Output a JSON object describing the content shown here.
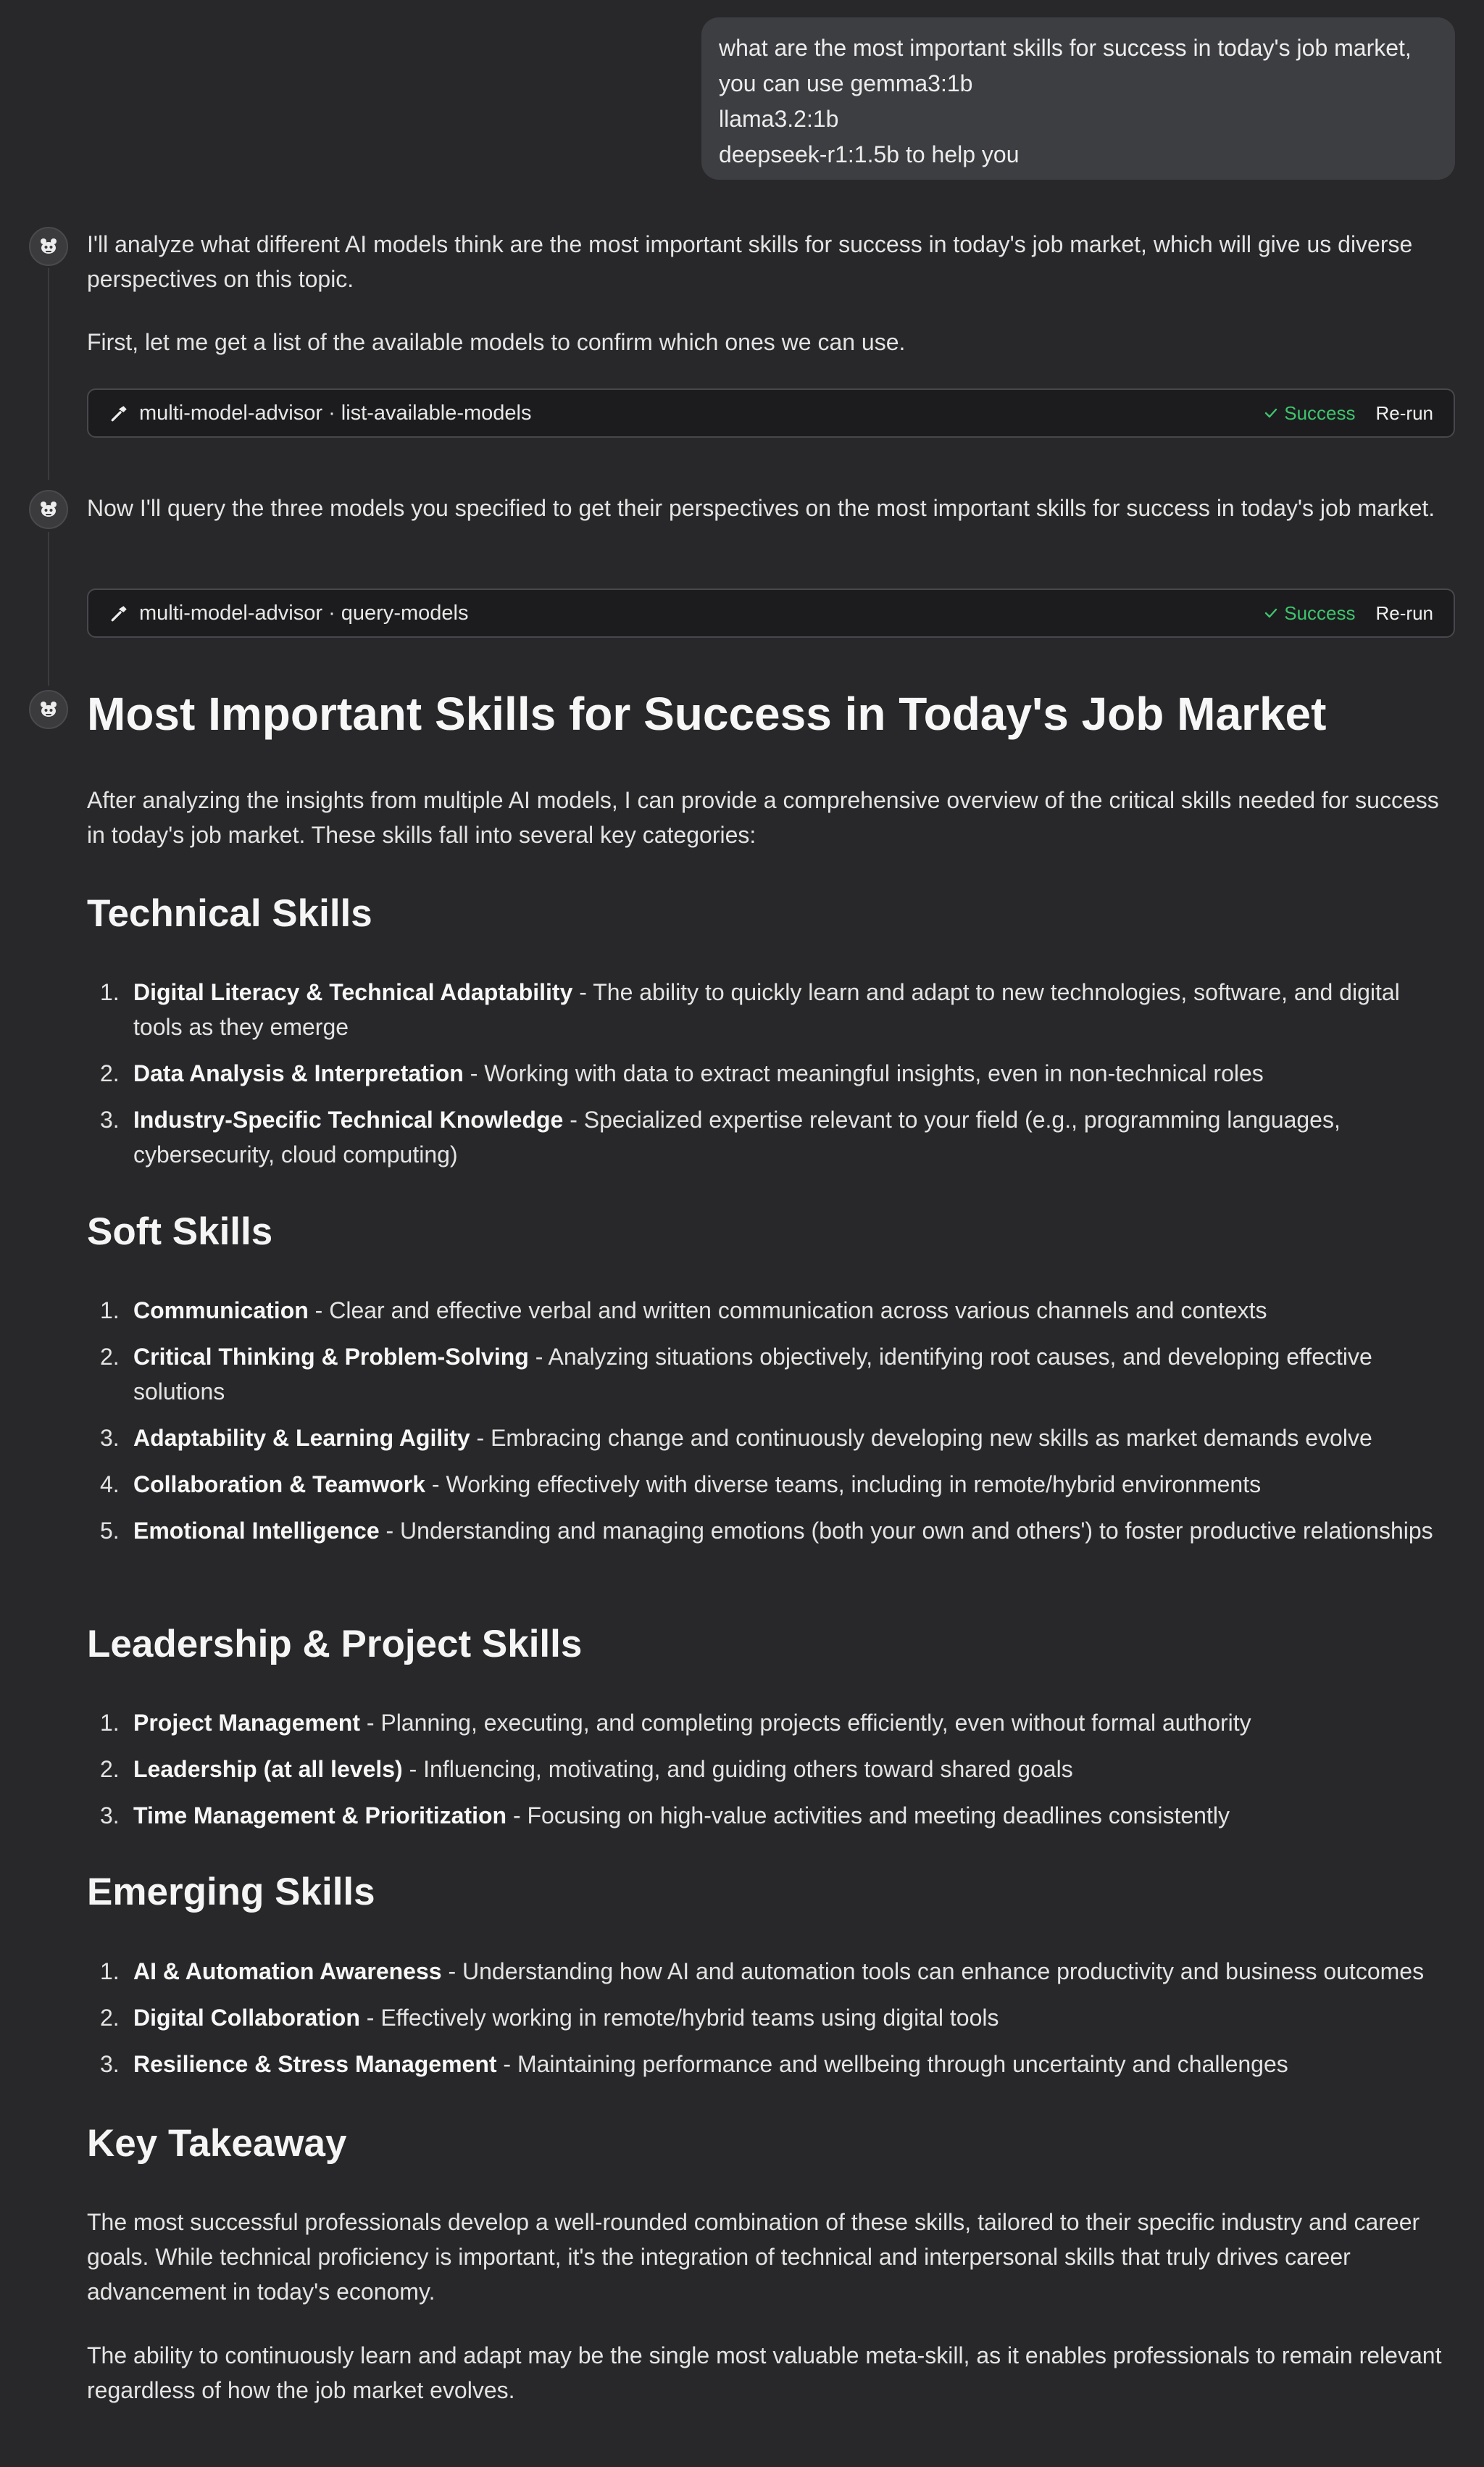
{
  "user_message": {
    "lines": [
      "what are the most important skills for success in today's job market,",
      "you can use gemma3:1b",
      "llama3.2:1b",
      "deepseek-r1:1.5b to help you"
    ]
  },
  "assistant": {
    "intro_1": "I'll analyze what different AI models think are the most important skills for success in today's job market, which will give us diverse perspectives on this topic.",
    "intro_2": "First, let me get a list of the available models to confirm which ones we can use.",
    "tool_1": {
      "name": "multi-model-advisor · list-available-models",
      "status": "Success",
      "rerun": "Re-run"
    },
    "query_text": "Now I'll query the three models you specified to get their perspectives on the most important skills for success in today's job market.",
    "tool_2": {
      "name": "multi-model-advisor · query-models",
      "status": "Success",
      "rerun": "Re-run"
    }
  },
  "answer": {
    "title": "Most Important Skills for Success in Today's Job Market",
    "intro": "After analyzing the insights from multiple AI models, I can provide a comprehensive overview of the critical skills needed for success in today's job market. These skills fall into several key categories:",
    "sections": [
      {
        "heading": "Technical Skills",
        "items": [
          {
            "num": "1.",
            "term": "Digital Literacy & Technical Adaptability",
            "desc": " - The ability to quickly learn and adapt to new technologies, software, and digital tools as they emerge"
          },
          {
            "num": "2.",
            "term": "Data Analysis & Interpretation",
            "desc": " - Working with data to extract meaningful insights, even in non-technical roles"
          },
          {
            "num": "3.",
            "term": "Industry-Specific Technical Knowledge",
            "desc": " - Specialized expertise relevant to your field (e.g., programming languages, cybersecurity, cloud computing)"
          }
        ]
      },
      {
        "heading": "Soft Skills",
        "items": [
          {
            "num": "1.",
            "term": "Communication",
            "desc": " - Clear and effective verbal and written communication across various channels and contexts"
          },
          {
            "num": "2.",
            "term": "Critical Thinking & Problem-Solving",
            "desc": " - Analyzing situations objectively, identifying root causes, and developing effective solutions"
          },
          {
            "num": "3.",
            "term": "Adaptability & Learning Agility",
            "desc": " - Embracing change and continuously developing new skills as market demands evolve"
          },
          {
            "num": "4.",
            "term": "Collaboration & Teamwork",
            "desc": " - Working effectively with diverse teams, including in remote/hybrid environments"
          },
          {
            "num": "5.",
            "term": "Emotional Intelligence",
            "desc": " - Understanding and managing emotions (both your own and others') to foster productive relationships"
          }
        ]
      },
      {
        "heading": "Leadership & Project Skills",
        "items": [
          {
            "num": "1.",
            "term": "Project Management",
            "desc": " - Planning, executing, and completing projects efficiently, even without formal authority"
          },
          {
            "num": "2.",
            "term": "Leadership (at all levels)",
            "desc": " - Influencing, motivating, and guiding others toward shared goals"
          },
          {
            "num": "3.",
            "term": "Time Management & Prioritization",
            "desc": " - Focusing on high-value activities and meeting deadlines consistently"
          }
        ]
      },
      {
        "heading": "Emerging Skills",
        "items": [
          {
            "num": "1.",
            "term": "AI & Automation Awareness",
            "desc": " - Understanding how AI and automation tools can enhance productivity and business outcomes"
          },
          {
            "num": "2.",
            "term": "Digital Collaboration",
            "desc": " - Effectively working in remote/hybrid teams using digital tools"
          },
          {
            "num": "3.",
            "term": "Resilience & Stress Management",
            "desc": " - Maintaining performance and wellbeing through uncertainty and challenges"
          }
        ]
      }
    ],
    "takeaway_heading": "Key Takeaway",
    "takeaway_1": "The most successful professionals develop a well-rounded combination of these skills, tailored to their specific industry and career goals. While technical proficiency is important, it's the integration of technical and interpersonal skills that truly drives career advancement in today's economy.",
    "takeaway_2": "The ability to continuously learn and adapt may be the single most valuable meta-skill, as it enables professionals to remain relevant regardless of how the job market evolves."
  },
  "icons": {
    "avatar": "assistant-avatar-icon",
    "tool": "hammer-icon",
    "status": "check-icon"
  },
  "colors": {
    "background": "#28282a",
    "user_bubble": "#3d3e42",
    "tool_card": "#1c1c1e",
    "success": "#3ec46d"
  }
}
